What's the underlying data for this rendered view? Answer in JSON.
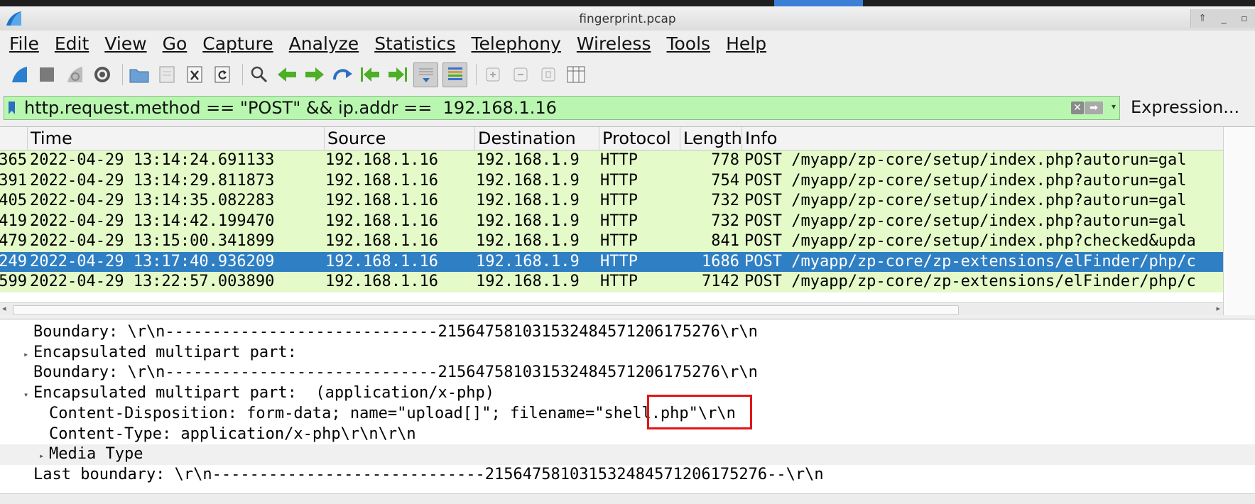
{
  "window": {
    "title": "fingerprint.pcap"
  },
  "menu": [
    {
      "key": "file",
      "label": "File"
    },
    {
      "key": "edit",
      "label": "Edit"
    },
    {
      "key": "view",
      "label": "View"
    },
    {
      "key": "go",
      "label": "Go"
    },
    {
      "key": "capture",
      "label": "Capture"
    },
    {
      "key": "analyze",
      "label": "Analyze"
    },
    {
      "key": "statistics",
      "label": "Statistics"
    },
    {
      "key": "telephony",
      "label": "Telephony"
    },
    {
      "key": "wireless",
      "label": "Wireless"
    },
    {
      "key": "tools",
      "label": "Tools"
    },
    {
      "key": "help",
      "label": "Help"
    }
  ],
  "toolbar_icons": [
    "start-capture-icon",
    "stop-capture-icon",
    "restart-capture-icon",
    "capture-options-icon",
    "open-file-icon",
    "save-file-icon",
    "close-file-icon",
    "reload-file-icon",
    "find-packet-icon",
    "go-back-icon",
    "go-forward-icon",
    "go-to-packet-icon",
    "first-packet-icon",
    "last-packet-icon",
    "autoscroll-icon",
    "colorize-icon",
    "zoom-in-icon",
    "zoom-out-icon",
    "normal-size-icon",
    "resize-columns-icon"
  ],
  "filter": {
    "value": "http.request.method == \"POST\" && ip.addr ==  192.168.1.16",
    "expression_label": "Expression...",
    "background": "#b9f7b0"
  },
  "packet_list": {
    "columns": [
      "Time",
      "Source",
      "Destination",
      "Protocol",
      "Length",
      "Info"
    ],
    "rows": [
      {
        "no": "365",
        "time": "2022-04-29 13:14:24.691133",
        "src": "192.168.1.16",
        "dst": "192.168.1.9",
        "proto": "HTTP",
        "len": "778",
        "info": "POST /myapp/zp-core/setup/index.php?autorun=gal",
        "selected": false
      },
      {
        "no": "391",
        "time": "2022-04-29 13:14:29.811873",
        "src": "192.168.1.16",
        "dst": "192.168.1.9",
        "proto": "HTTP",
        "len": "754",
        "info": "POST /myapp/zp-core/setup/index.php?autorun=gal",
        "selected": false
      },
      {
        "no": "405",
        "time": "2022-04-29 13:14:35.082283",
        "src": "192.168.1.16",
        "dst": "192.168.1.9",
        "proto": "HTTP",
        "len": "732",
        "info": "POST /myapp/zp-core/setup/index.php?autorun=gal",
        "selected": false
      },
      {
        "no": "419",
        "time": "2022-04-29 13:14:42.199470",
        "src": "192.168.1.16",
        "dst": "192.168.1.9",
        "proto": "HTTP",
        "len": "732",
        "info": "POST /myapp/zp-core/setup/index.php?autorun=gal",
        "selected": false
      },
      {
        "no": "479",
        "time": "2022-04-29 13:15:00.341899",
        "src": "192.168.1.16",
        "dst": "192.168.1.9",
        "proto": "HTTP",
        "len": "841",
        "info": "POST /myapp/zp-core/setup/index.php?checked&upda",
        "selected": false
      },
      {
        "no": "249",
        "time": "2022-04-29 13:17:40.936209",
        "src": "192.168.1.16",
        "dst": "192.168.1.9",
        "proto": "HTTP",
        "len": "1686",
        "info": "POST /myapp/zp-core/zp-extensions/elFinder/php/c",
        "selected": true
      },
      {
        "no": "599",
        "time": "2022-04-29 13:22:57.003890",
        "src": "192.168.1.16",
        "dst": "192.168.1.9",
        "proto": "HTTP",
        "len": "7142",
        "info": "POST /myapp/zp-core/zp-extensions/elFinder/php/c",
        "selected": false
      }
    ],
    "row_color": "#e4fbc9",
    "selected_color": "#2f7fc4"
  },
  "details": [
    {
      "indent": 1,
      "arrow": "",
      "text": "Boundary: \\r\\n-----------------------------215647581031532484571206175276\\r\\n"
    },
    {
      "indent": 1,
      "arrow": "▸",
      "text": "Encapsulated multipart part:"
    },
    {
      "indent": 1,
      "arrow": "",
      "text": "Boundary: \\r\\n-----------------------------215647581031532484571206175276\\r\\n"
    },
    {
      "indent": 1,
      "arrow": "▾",
      "text": "Encapsulated multipart part:  (application/x-php)"
    },
    {
      "indent": 2,
      "arrow": "",
      "text": "Content-Disposition: form-data; name=\"upload[]\"; filename=\"shell.php\"\\r\\n"
    },
    {
      "indent": 2,
      "arrow": "",
      "text": "Content-Type: application/x-php\\r\\n\\r\\n"
    },
    {
      "indent": 2,
      "arrow": "▸",
      "text": "Media Type"
    },
    {
      "indent": 1,
      "arrow": "",
      "text": "Last boundary: \\r\\n-----------------------------215647581031532484571206175276--\\r\\n"
    }
  ],
  "highlight_color": "#e01616"
}
